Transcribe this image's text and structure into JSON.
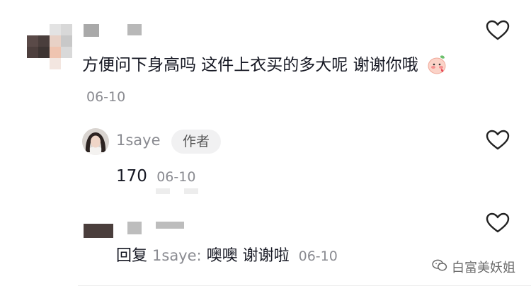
{
  "comments": [
    {
      "text": "方便问下身高吗 这件上衣买的多大呢 谢谢你哦",
      "date": "06-10",
      "heart_icon": "heart-outline-icon"
    }
  ],
  "replies": [
    {
      "username": "1saye",
      "badge": "作者",
      "text": "170",
      "date": "06-10"
    },
    {
      "reply_prefix": "回复",
      "target": "1saye:",
      "text": "噢噢 谢谢啦",
      "date": "06-10"
    }
  ],
  "watermark": "白富美妖姐",
  "colors": {
    "text": "#161823",
    "muted": "#8a8b91",
    "badge_bg": "#f1f1f2"
  }
}
